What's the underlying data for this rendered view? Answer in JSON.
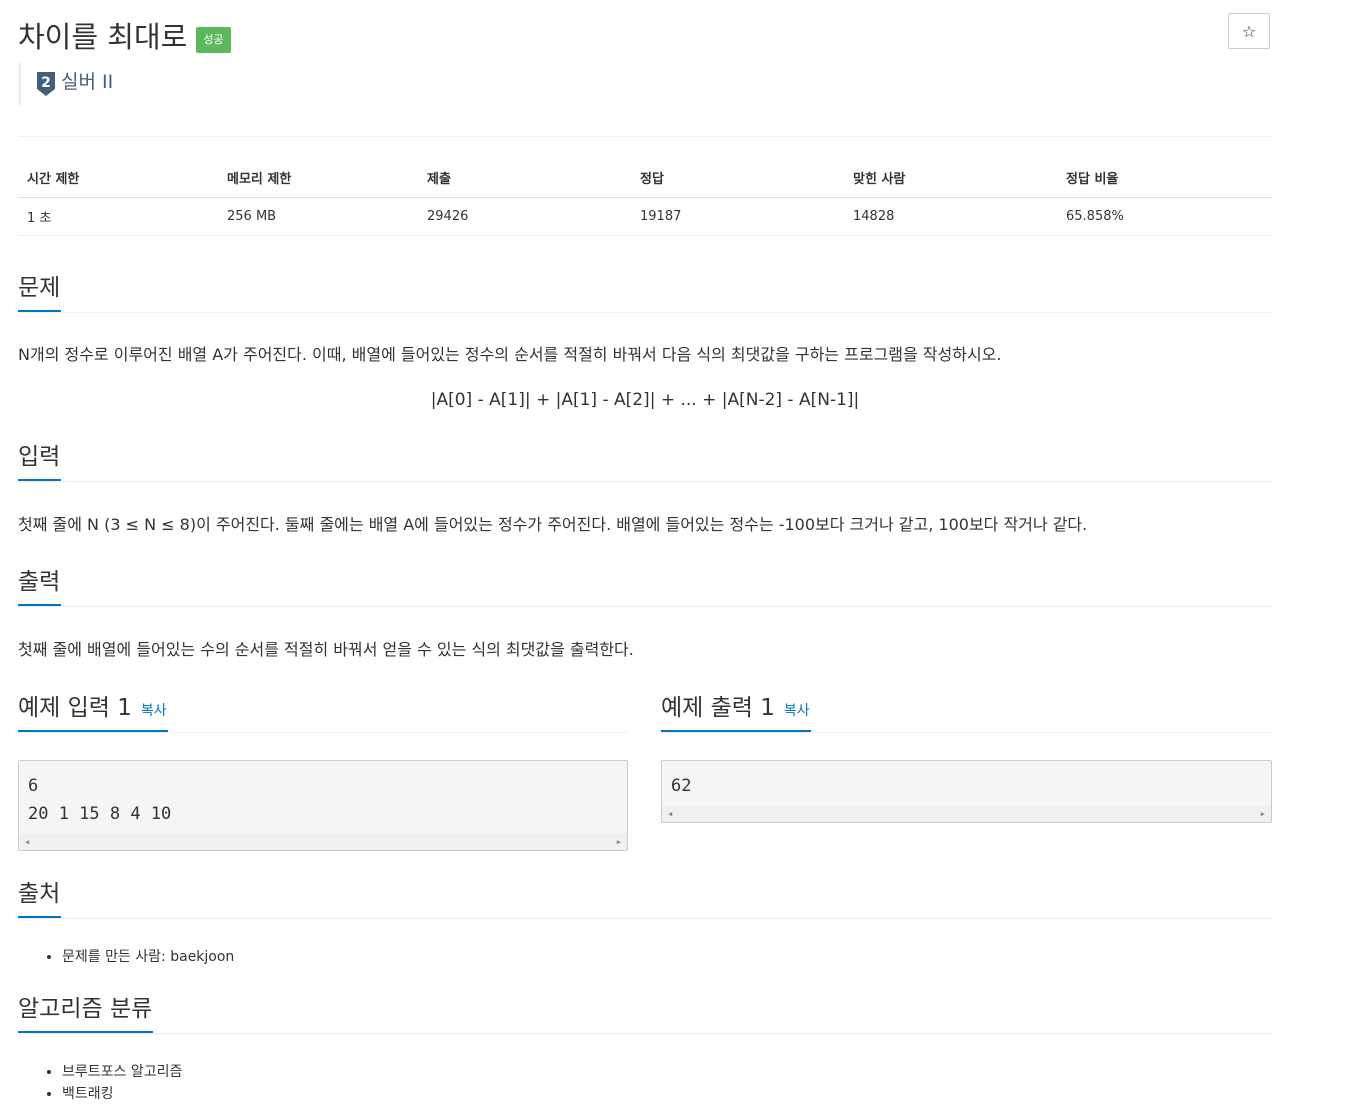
{
  "problem": {
    "title": "차이를 최대로",
    "status_badge": "성공",
    "star_icon": "☆",
    "tier": {
      "level": "2",
      "name": "실버 II",
      "color": "#435f7a"
    }
  },
  "info_table": {
    "headers": [
      "시간 제한",
      "메모리 제한",
      "제출",
      "정답",
      "맞힌 사람",
      "정답 비율"
    ],
    "values": [
      "1 초",
      "256 MB",
      "29426",
      "19187",
      "14828",
      "65.858%"
    ]
  },
  "sections": {
    "description": {
      "title": "문제",
      "text": "N개의 정수로 이루어진 배열 A가 주어진다. 이때, 배열에 들어있는 정수의 순서를 적절히 바꿔서 다음 식의 최댓값을 구하는 프로그램을 작성하시오.",
      "formula": "|A[0] - A[1]| + |A[1] - A[2]| + ... + |A[N-2] - A[N-1]|"
    },
    "input": {
      "title": "입력",
      "text": "첫째 줄에 N (3 ≤ N ≤ 8)이 주어진다. 둘째 줄에는 배열 A에 들어있는 정수가 주어진다. 배열에 들어있는 정수는 -100보다 크거나 같고, 100보다 작거나 같다."
    },
    "output": {
      "title": "출력",
      "text": "첫째 줄에 배열에 들어있는 수의 순서를 적절히 바꿔서 얻을 수 있는 식의 최댓값을 출력한다."
    },
    "sample_input": {
      "title": "예제 입력 1",
      "copy_label": "복사",
      "lines": [
        "6",
        "20 1 15 8 4 10"
      ]
    },
    "sample_output": {
      "title": "예제 출력 1",
      "copy_label": "복사",
      "lines": [
        "62"
      ]
    },
    "source": {
      "title": "출처",
      "items": [
        "문제를 만든 사람: baekjoon"
      ]
    },
    "tags": {
      "title": "알고리즘 분류",
      "items": [
        "브루트포스 알고리즘",
        "백트래킹"
      ]
    }
  },
  "colors": {
    "accent": "#0076c0",
    "success": "#5cb85c"
  }
}
